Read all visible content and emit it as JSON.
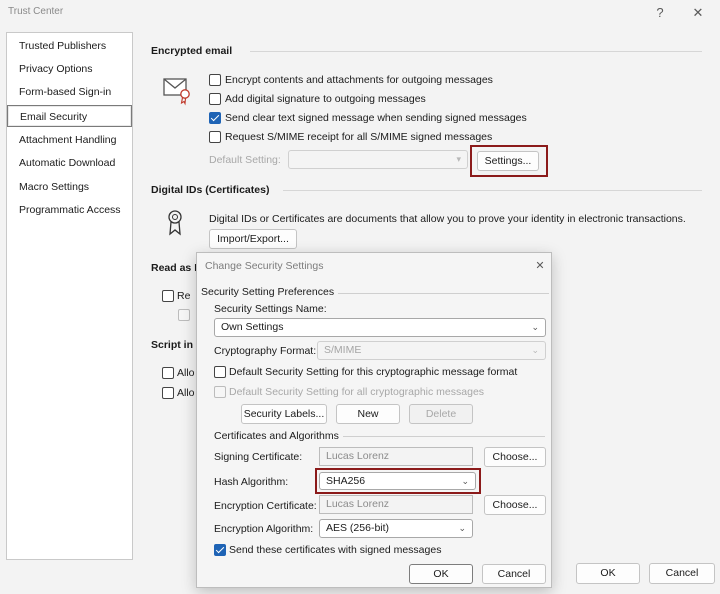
{
  "window": {
    "title": "Trust Center",
    "help": "?",
    "close": "✕"
  },
  "sidebar": {
    "items": [
      {
        "label": "Trusted Publishers"
      },
      {
        "label": "Privacy Options"
      },
      {
        "label": "Form-based Sign-in"
      },
      {
        "label": "Email Security"
      },
      {
        "label": "Attachment Handling"
      },
      {
        "label": "Automatic Download"
      },
      {
        "label": "Macro Settings"
      },
      {
        "label": "Programmatic Access"
      }
    ],
    "selected": "Email Security"
  },
  "encrypted_email": {
    "heading": "Encrypted email",
    "options": [
      {
        "label": "Encrypt contents and attachments for outgoing messages",
        "checked": false
      },
      {
        "label": "Add digital signature to outgoing messages",
        "checked": false
      },
      {
        "label": "Send clear text signed message when sending signed messages",
        "checked": true
      },
      {
        "label": "Request S/MIME receipt for all S/MIME signed messages",
        "checked": false
      }
    ],
    "default_setting_label": "Default Setting:",
    "default_setting_value": "",
    "settings_button": "Settings..."
  },
  "digital_ids": {
    "heading": "Digital IDs (Certificates)",
    "description": "Digital IDs or Certificates are documents that allow you to prove your identity in electronic transactions.",
    "import_export_button": "Import/Export..."
  },
  "read_as_plain": {
    "heading_partial": "Read as P",
    "option_partial": "Re"
  },
  "script_in": {
    "heading_partial": "Script in",
    "options_partial": [
      "Allo",
      "Allo"
    ]
  },
  "footer": {
    "ok": "OK",
    "cancel": "Cancel"
  },
  "dialog": {
    "title": "Change Security Settings",
    "close": "✕",
    "group_preferences": "Security Setting Preferences",
    "name_label": "Security Settings Name:",
    "name_value": "Own Settings",
    "crypto_format_label": "Cryptography Format:",
    "crypto_format_value": "S/MIME",
    "default_for_format": {
      "label": "Default Security Setting for this cryptographic message format",
      "checked": false
    },
    "default_for_all": {
      "label": "Default Security Setting for all cryptographic messages",
      "checked": false,
      "disabled": true
    },
    "security_labels_button": "Security Labels...",
    "new_button": "New",
    "delete_button": "Delete",
    "group_certs": "Certificates and Algorithms",
    "signing_cert_label": "Signing Certificate:",
    "signing_cert_value": "Lucas Lorenz",
    "choose_button_1": "Choose...",
    "hash_label": "Hash Algorithm:",
    "hash_value": "SHA256",
    "enc_cert_label": "Encryption Certificate:",
    "enc_cert_value": "Lucas Lorenz",
    "choose_button_2": "Choose...",
    "enc_alg_label": "Encryption Algorithm:",
    "enc_alg_value": "AES (256-bit)",
    "send_certs": {
      "label": "Send these certificates with signed messages",
      "checked": true
    },
    "ok": "OK",
    "cancel": "Cancel"
  },
  "colors": {
    "highlight": "#8b1a1a",
    "accent": "#1e63b5"
  }
}
